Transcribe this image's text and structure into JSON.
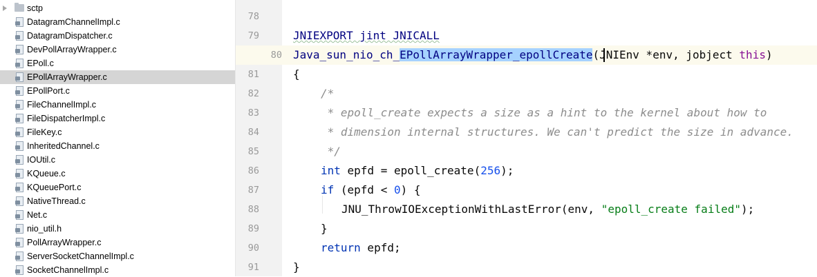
{
  "tree": {
    "items": [
      {
        "label": "sctp",
        "type": "folder"
      },
      {
        "label": "DatagramChannelImpl.c",
        "type": "file"
      },
      {
        "label": "DatagramDispatcher.c",
        "type": "file"
      },
      {
        "label": "DevPollArrayWrapper.c",
        "type": "file"
      },
      {
        "label": "EPoll.c",
        "type": "file"
      },
      {
        "label": "EPollArrayWrapper.c",
        "type": "file",
        "selected": true
      },
      {
        "label": "EPollPort.c",
        "type": "file"
      },
      {
        "label": "FileChannelImpl.c",
        "type": "file"
      },
      {
        "label": "FileDispatcherImpl.c",
        "type": "file"
      },
      {
        "label": "FileKey.c",
        "type": "file"
      },
      {
        "label": "InheritedChannel.c",
        "type": "file"
      },
      {
        "label": "IOUtil.c",
        "type": "file"
      },
      {
        "label": "KQueue.c",
        "type": "file"
      },
      {
        "label": "KQueuePort.c",
        "type": "file"
      },
      {
        "label": "NativeThread.c",
        "type": "file"
      },
      {
        "label": "Net.c",
        "type": "file"
      },
      {
        "label": "nio_util.h",
        "type": "file"
      },
      {
        "label": "PollArrayWrapper.c",
        "type": "file"
      },
      {
        "label": "ServerSocketChannelImpl.c",
        "type": "file"
      },
      {
        "label": "SocketChannelImpl.c",
        "type": "file"
      }
    ]
  },
  "editor": {
    "line_numbers": [
      "78",
      "79",
      "80",
      "81",
      "82",
      "83",
      "84",
      "85",
      "86",
      "87",
      "88",
      "89",
      "90",
      "91"
    ],
    "current_line": "80",
    "code": {
      "l79": "JNIEXPORT jint JNICALL",
      "l80_prefix": "Java_sun_nio_ch_",
      "l80_selected": "EPollArrayWrapper_epollCreate",
      "l80_paren": "(",
      "l80_params": "JNIEnv *env, jobject ",
      "l80_this": "this",
      "l80_close": ")",
      "l81": "{",
      "l82": "/*",
      "l83": " * epoll_create expects a size as a hint to the kernel about how to",
      "l84": " * dimension internal structures. We can't predict the size in advance.",
      "l85": " */",
      "l86_kw": "int",
      "l86_mid": " epfd = epoll_create(",
      "l86_num": "256",
      "l86_end": ");",
      "l87_kw": "if",
      "l87_mid": " (epfd < ",
      "l87_num": "0",
      "l87_end": ") {",
      "l88_fn": "JNU_ThrowIOExceptionWithLastError(env, ",
      "l88_str": "\"epoll_create failed\"",
      "l88_end": ");",
      "l89": "}",
      "l90_kw": "return",
      "l90_end": " epfd;",
      "l91": "}"
    }
  }
}
